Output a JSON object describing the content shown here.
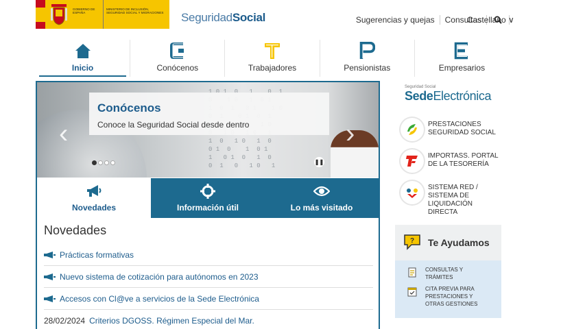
{
  "header": {
    "gov_logo": {
      "left_text": "GOBIERNO DE ESPAÑA",
      "right_text": "MINISTERIO DE INCLUSIÓN, SEGURIDAD SOCIAL Y MIGRACIONES"
    },
    "site_logo": {
      "part1": "Seguridad",
      "part2": "Social"
    },
    "links": [
      "Sugerencias y quejas",
      "Consultas"
    ],
    "language": "Castellano ∨"
  },
  "mainnav": [
    {
      "label": "Inicio",
      "icon": "home-icon"
    },
    {
      "label": "Conócenos",
      "icon": "letter-c-icon"
    },
    {
      "label": "Trabajadores",
      "icon": "letter-t-icon"
    },
    {
      "label": "Pensionistas",
      "icon": "letter-p-icon"
    },
    {
      "label": "Empresarios",
      "icon": "letter-e-icon"
    }
  ],
  "carousel": {
    "title": "Conócenos",
    "subtitle": "Conoce la Seguridad Social desde dentro",
    "slides": 4,
    "active_slide": 1
  },
  "tabs": [
    {
      "label": "Novedades",
      "icon": "megaphone-icon",
      "active": true
    },
    {
      "label": "Información útil",
      "icon": "crosshair-icon",
      "active": false
    },
    {
      "label": "Lo más visitado",
      "icon": "eye-icon",
      "active": false
    }
  ],
  "news": {
    "heading": "Novedades",
    "items": [
      {
        "date": "",
        "text": "Prácticas formativas"
      },
      {
        "date": "",
        "text": "Nuevo sistema de cotización para autónomos en 2023"
      },
      {
        "date": "",
        "text": "Accesos con Cl@ve a servicios de la Sede Electrónica"
      },
      {
        "date": "28/02/2024",
        "text": "Criterios DGOSS. Régimen Especial del Mar."
      }
    ]
  },
  "sidebar": {
    "sede": {
      "small": "Seguridad Social",
      "part1": "Sede",
      "part2": "Electrónica"
    },
    "services": [
      {
        "line1": "PRESTACIONES",
        "line2": "SEGURIDAD SOCIAL",
        "line3": "",
        "line4": "",
        "icon": "prestaciones-icon"
      },
      {
        "line1": "IMPORTASS. PORTAL",
        "line2": "DE LA TESORERÍA",
        "line3": "",
        "line4": "",
        "icon": "importass-icon"
      },
      {
        "line1": "SISTEMA RED /",
        "line2": "SISTEMA DE",
        "line3": "LIQUIDACIÓN",
        "line4": "DIRECTA",
        "icon": "sistema-red-icon"
      }
    ],
    "help": {
      "title": "Te Ayudamos",
      "items": [
        {
          "line1": "CONSULTAS Y",
          "line2": "TRÁMITES",
          "line3": "",
          "icon": "document-icon"
        },
        {
          "line1": "CITA PREVIA PARA",
          "line2": "PRESTACIONES Y",
          "line3": "OTRAS GESTIONES",
          "icon": "calendar-icon"
        }
      ]
    }
  },
  "colors": {
    "primary": "#1d6a8f",
    "link": "#1d5c8c",
    "gov_yellow": "#f6c500",
    "help_bg": "#dbe9f5"
  }
}
